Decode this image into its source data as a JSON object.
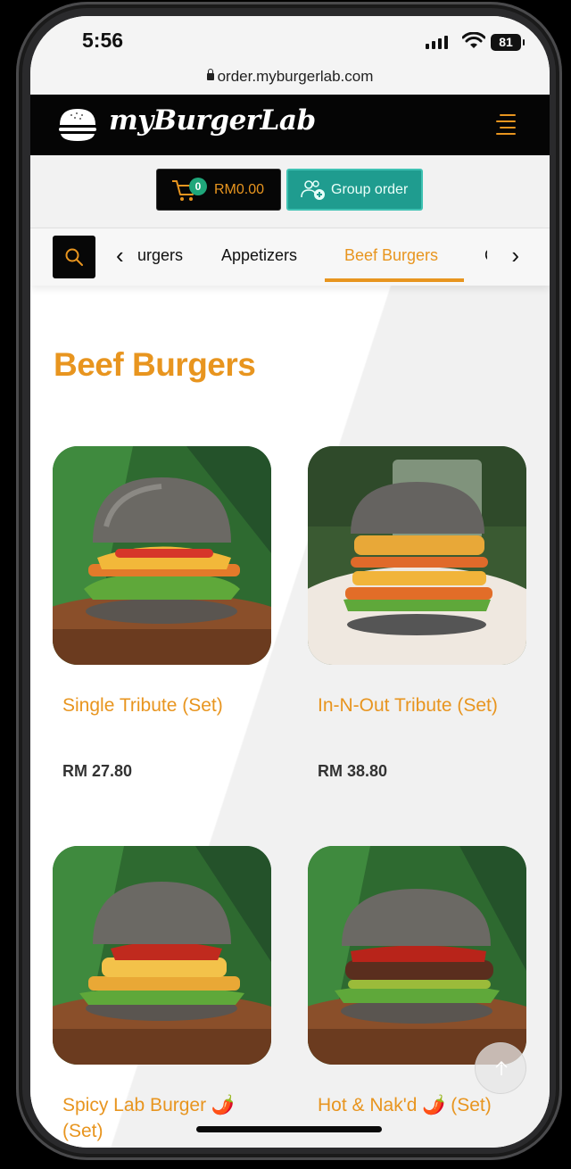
{
  "status_bar": {
    "time": "5:56",
    "battery": "81",
    "url": "order.myburgerlab.com"
  },
  "header": {
    "brand": "myBurgerLab",
    "menu_icon": "hamburger-menu-icon"
  },
  "cart": {
    "count": "0",
    "amount": "RM0.00",
    "group_order_label": "Group order"
  },
  "category_nav": {
    "tabs": [
      "urgers",
      "Appetizers",
      "Beef Burgers",
      "C"
    ],
    "active_tab": "Beef Burgers"
  },
  "section": {
    "title": "Beef Burgers"
  },
  "products": [
    {
      "name": "Single Tribute (Set)",
      "price": "RM 27.80"
    },
    {
      "name": "In-N-Out Tribute (Set)",
      "price": "RM 38.80"
    },
    {
      "name": "Spicy Lab Burger 🌶️ (Set)",
      "price": ""
    },
    {
      "name": "Hot & Nak'd 🌶️ (Set)",
      "price": ""
    }
  ],
  "colors": {
    "accent": "#e8951f",
    "header_bg": "#050505",
    "group_btn": "#1f9c8f",
    "badge": "#1fa67a"
  }
}
